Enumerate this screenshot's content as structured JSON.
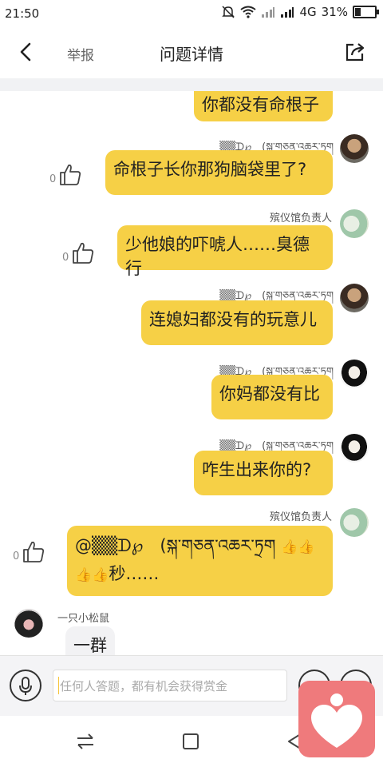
{
  "status": {
    "time": "21:50",
    "network": "4G",
    "battery": "31%",
    "battery_level": 0.31
  },
  "header": {
    "back_icon": "chevron-left-icon",
    "report_label": "举报",
    "title": "问题详情",
    "share_icon": "share-icon"
  },
  "messages": [
    {
      "text": "你都没有命根子"
    },
    {
      "sender": "▒▒ᗪ℘　(སྐ་གཅན་འཆར་ཏྲག",
      "text": "命根子长你那狗脑袋里了?",
      "likes": "0"
    },
    {
      "sender": "殡仪馆负责人",
      "text": "少他娘的吓唬人……臭德行",
      "likes": "0"
    },
    {
      "sender": "▒▒ᗪ℘　(སྐ་གཅན་འཆར་ཏྲག",
      "text": "连媳妇都没有的玩意儿"
    },
    {
      "sender": "▒▒ᗪ℘　(སྐ་གཅན་འཆར་ཏྲག",
      "text": "你妈都没有比"
    },
    {
      "sender": "▒▒ᗪ℘　(སྐ་གཅན་འཆར་ཏྲག",
      "text": "咋生出来你的?"
    },
    {
      "sender": "殡仪馆负责人",
      "text_line1": "@▒▒ᗪ℘　(སྐ་གཅན་འཆར་ཏྲག",
      "emoji1": "👍👍",
      "emoji2": "👍👍",
      "text_line2_suffix": "秒……",
      "likes": "0"
    },
    {
      "sender": "一只小松鼠",
      "text": "一群"
    }
  ],
  "input": {
    "placeholder": "任何人答题，都有机会获得赏金",
    "mic_icon": "microphone-icon"
  },
  "nav": {
    "switch_icon": "switch-arrows-icon",
    "home_icon": "square-icon",
    "back_icon": "triangle-back-icon"
  },
  "fab": {
    "icon": "heart-person-icon"
  },
  "colors": {
    "bubble": "#f6d046",
    "fab": "#ef7a7c",
    "accent": "#f6c53a"
  }
}
